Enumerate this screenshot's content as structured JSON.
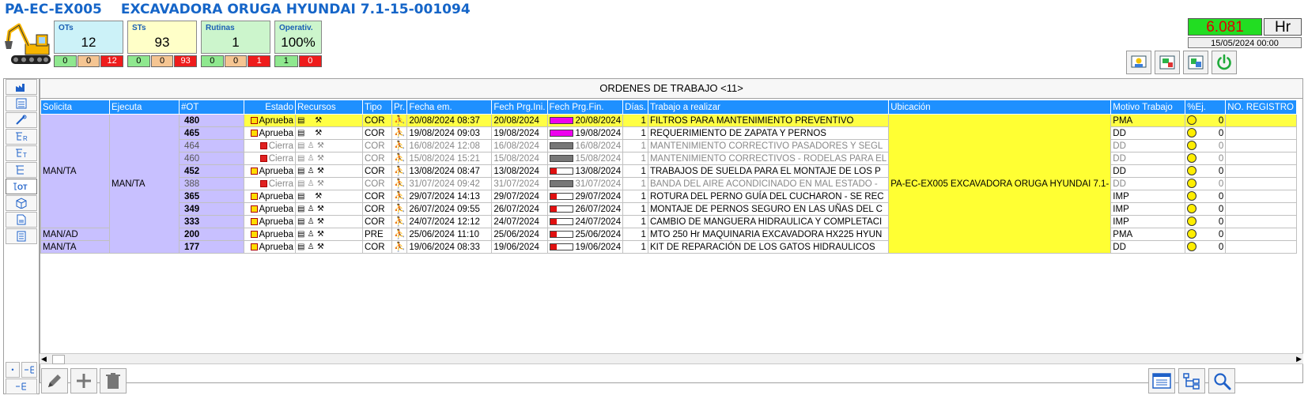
{
  "header": {
    "code": "PA-EC-EX005",
    "name": "EXCAVADORA ORUGA HYUNDAI 7.1-15-001094"
  },
  "kpis": [
    {
      "label": "OTs",
      "value": "12",
      "bg": "#ccf2f8",
      "cells": [
        "0",
        "0",
        "12"
      ]
    },
    {
      "label": "STs",
      "value": "93",
      "bg": "#ffffc8",
      "cells": [
        "0",
        "0",
        "93"
      ]
    },
    {
      "label": "Rutinas",
      "value": "1",
      "bg": "#ccf5cc",
      "cells": [
        "0",
        "0",
        "1"
      ]
    },
    {
      "label": "Operativ.",
      "value": "100%",
      "bg": "#ccf5cc",
      "cells": [
        "1",
        "0"
      ]
    }
  ],
  "hours": {
    "value": "6.081",
    "unit": "Hr",
    "date": "15/05/2024 00:00"
  },
  "grid": {
    "title": "ORDENES DE TRABAJO <11>",
    "columns": [
      "Solicita",
      "Ejecuta",
      "#OT",
      "Estado",
      "Recursos",
      "Tipo",
      "Pr.",
      "Fecha em.",
      "Fech Prg.Ini.",
      "Fech Prg.Fin.",
      "Días.",
      "Trabajo a realizar",
      "Ubicación",
      "Motivo Trabajo",
      "%Ej.",
      "NO. REGISTRO"
    ],
    "ubicacion": "PA-EC-EX005  EXCAVADORA ORUGA HYUNDAI 7.1-",
    "rows": [
      {
        "solicita": "MAN/TA",
        "ejecuta": "MAN/TA",
        "ot": "480",
        "estado": "Aprueba",
        "tipo": "COR",
        "fecha_em": "20/08/2024 08:37",
        "ini": "20/08/2024",
        "fin": "20/08/2024",
        "dias": "1",
        "trabajo": "FILTROS PARA MANTENIMIENTO PREVENTIVO",
        "motivo": "PMA",
        "ej": "0",
        "st": "y",
        "bar": "m",
        "person": false,
        "closed": false,
        "sel": true
      },
      {
        "solicita": "MAN/TA",
        "ejecuta": "MAN/TA",
        "ot": "465",
        "estado": "Aprueba",
        "tipo": "COR",
        "fecha_em": "19/08/2024 09:03",
        "ini": "19/08/2024",
        "fin": "19/08/2024",
        "dias": "1",
        "trabajo": "REQUERIMIENTO DE ZAPATA Y PERNOS",
        "motivo": "DD",
        "ej": "0",
        "st": "y",
        "bar": "m",
        "person": false,
        "closed": false,
        "sel": false
      },
      {
        "solicita": "MAN/TA",
        "ejecuta": "MAN/TA",
        "ot": "464",
        "estado": "Cierra",
        "tipo": "COR",
        "fecha_em": "16/08/2024 12:08",
        "ini": "16/08/2024",
        "fin": "16/08/2024",
        "dias": "1",
        "trabajo": "MANTENIMIENTO CORRECTIVO PASADORES Y SEGL",
        "motivo": "DD",
        "ej": "0",
        "st": "r",
        "bar": "g",
        "person": true,
        "closed": true,
        "sel": false
      },
      {
        "solicita": "MAN/TA",
        "ejecuta": "MAN/TA",
        "ot": "460",
        "estado": "Cierra",
        "tipo": "COR",
        "fecha_em": "15/08/2024 15:21",
        "ini": "15/08/2024",
        "fin": "15/08/2024",
        "dias": "1",
        "trabajo": "MANTENIMIENTO CORRECTIVOS - RODELAS PARA EL",
        "motivo": "DD",
        "ej": "0",
        "st": "r",
        "bar": "g",
        "person": true,
        "closed": true,
        "sel": false
      },
      {
        "solicita": "MAN/TA",
        "ejecuta": "MAN/TA",
        "ot": "452",
        "estado": "Aprueba",
        "tipo": "COR",
        "fecha_em": "13/08/2024 08:47",
        "ini": "13/08/2024",
        "fin": "13/08/2024",
        "dias": "1",
        "trabajo": "TRABAJOS DE SUELDA PARA EL MONTAJE DE LOS P",
        "motivo": "DD",
        "ej": "0",
        "st": "y",
        "bar": "r",
        "person": true,
        "closed": false,
        "sel": false
      },
      {
        "solicita": "MAN/TA",
        "ejecuta": "MAN/TA",
        "ot": "388",
        "estado": "Cierra",
        "tipo": "COR",
        "fecha_em": "31/07/2024 09:42",
        "ini": "31/07/2024",
        "fin": "31/07/2024",
        "dias": "1",
        "trabajo": "BANDA DEL AIRE ACONDICINADO EN MAL ESTADO -",
        "motivo": "DD",
        "ej": "0",
        "st": "r",
        "bar": "g",
        "person": true,
        "closed": true,
        "sel": false
      },
      {
        "solicita": "MAN/TA",
        "ejecuta": "MAN/TA",
        "ot": "365",
        "estado": "Aprueba",
        "tipo": "COR",
        "fecha_em": "29/07/2024 14:13",
        "ini": "29/07/2024",
        "fin": "29/07/2024",
        "dias": "1",
        "trabajo": "ROTURA DEL PERNO GUÍA DEL CUCHARON - SE REC",
        "motivo": "IMP",
        "ej": "0",
        "st": "y",
        "bar": "r",
        "person": false,
        "closed": false,
        "sel": false
      },
      {
        "solicita": "MAN/TA",
        "ejecuta": "MAN/TA",
        "ot": "349",
        "estado": "Aprueba",
        "tipo": "COR",
        "fecha_em": "26/07/2024 09:55",
        "ini": "26/07/2024",
        "fin": "26/07/2024",
        "dias": "1",
        "trabajo": "MONTAJE DE PERNOS SEGURO EN LAS UÑAS DEL C",
        "motivo": "IMP",
        "ej": "0",
        "st": "y",
        "bar": "r",
        "person": true,
        "closed": false,
        "sel": false
      },
      {
        "solicita": "MAN/TA",
        "ejecuta": "MAN/TA",
        "ot": "333",
        "estado": "Aprueba",
        "tipo": "COR",
        "fecha_em": "24/07/2024 12:12",
        "ini": "24/07/2024",
        "fin": "24/07/2024",
        "dias": "1",
        "trabajo": "CAMBIO DE MANGUERA HIDRAULICA Y COMPLETACI",
        "motivo": "IMP",
        "ej": "0",
        "st": "y",
        "bar": "r",
        "person": true,
        "closed": false,
        "sel": false
      },
      {
        "solicita": "MAN/AD",
        "ejecuta": "MAN/TA",
        "ot": "200",
        "estado": "Aprueba",
        "tipo": "PRE",
        "fecha_em": "25/06/2024 11:10",
        "ini": "25/06/2024",
        "fin": "25/06/2024",
        "dias": "1",
        "trabajo": "MTO 250 Hr MAQUINARIA EXCAVADORA HX225 HYUN",
        "motivo": "PMA",
        "ej": "0",
        "st": "y",
        "bar": "r",
        "person": true,
        "closed": false,
        "sel": false
      },
      {
        "solicita": "MAN/TA",
        "ejecuta": "MAN/TA",
        "ot": "177",
        "estado": "Aprueba",
        "tipo": "COR",
        "fecha_em": "19/06/2024 08:33",
        "ini": "19/06/2024",
        "fin": "19/06/2024",
        "dias": "1",
        "trabajo": "KIT DE REPARACIÓN DE LOS GATOS HIDRAULICOS",
        "motivo": "DD",
        "ej": "0",
        "st": "y",
        "bar": "r",
        "person": true,
        "closed": false,
        "sel": false
      }
    ]
  },
  "colors": {
    "status_yellow": "#ffdd00",
    "status_red": "#e02020",
    "bar_magenta": "#ee00ee",
    "bar_red": "#e01010",
    "bar_gray": "#777777"
  }
}
